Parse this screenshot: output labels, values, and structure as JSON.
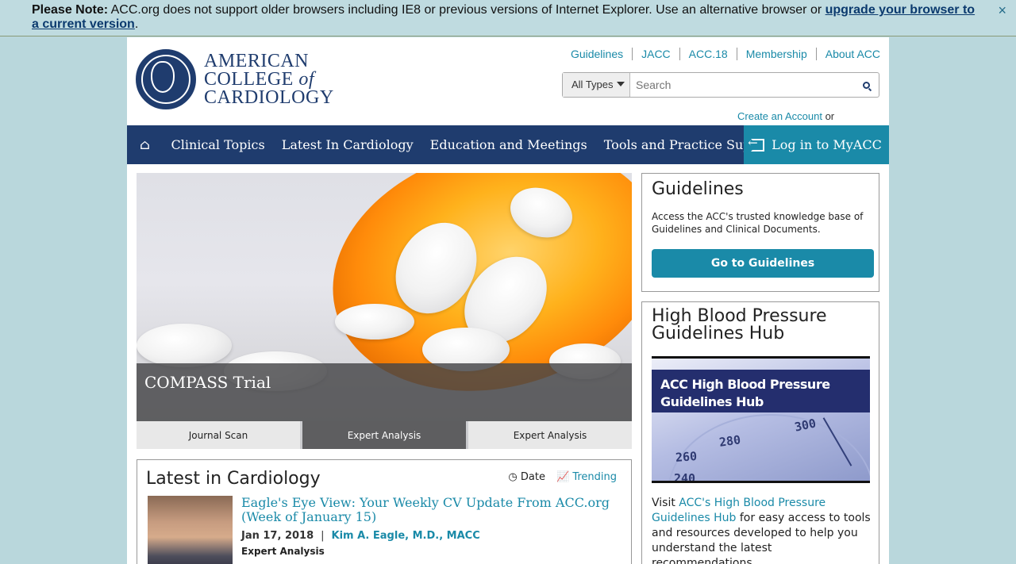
{
  "notice": {
    "label": "Please Note:",
    "text": " ACC.org does not support older browsers including IE8 or previous versions of Internet Explorer. Use an alternative browser or ",
    "link": "upgrade your browser to a current version",
    "end": ".",
    "close": "×"
  },
  "logo": {
    "line1": "AMERICAN",
    "line2a": "COLLEGE",
    "line2b": "of",
    "line3": "CARDIOLOGY"
  },
  "toplinks": [
    "Guidelines",
    "JACC",
    "ACC.18",
    "Membership",
    "About ACC"
  ],
  "search": {
    "types": "All Types",
    "placeholder": "Search"
  },
  "account": {
    "create": "Create an Account",
    "or": " or"
  },
  "nav": {
    "items": [
      "Clinical Topics",
      "Latest In Cardiology",
      "Education and Meetings",
      "Tools and Practice Support"
    ],
    "login": "Log in to MyACC"
  },
  "hero": {
    "caption": "COMPASS Trial",
    "tabs": [
      "Journal Scan",
      "Expert Analysis",
      "Expert Analysis"
    ]
  },
  "latest": {
    "heading": "Latest in Cardiology",
    "sort_date": "Date",
    "sort_trending": "Trending",
    "article": {
      "title": "Eagle's Eye View: Your Weekly CV Update From ACC.org (Week of January 15)",
      "date": "Jan 17, 2018",
      "sep": "|",
      "author": "Kim A. Eagle, M.D., MACC",
      "type": "Expert Analysis"
    }
  },
  "guidelines_card": {
    "heading": "Guidelines",
    "text": "Access the ACC's trusted knowledge base of Guidelines and Clinical Documents.",
    "button": "Go to Guidelines"
  },
  "hbp_card": {
    "heading": "High Blood Pressure Guidelines Hub",
    "banner_text": "ACC High Blood Pressure Guidelines Hub",
    "gauge_numbers": [
      "300",
      "280",
      "260",
      "240"
    ],
    "text_before": "Visit ",
    "link": "ACC's High Blood Pressure Guidelines Hub",
    "text_after": " for easy access to tools and resources developed to help you understand the latest recommendations."
  },
  "colors": {
    "navy": "#1f3c6e",
    "teal": "#1a8aa8",
    "background": "#b9d7dc"
  }
}
